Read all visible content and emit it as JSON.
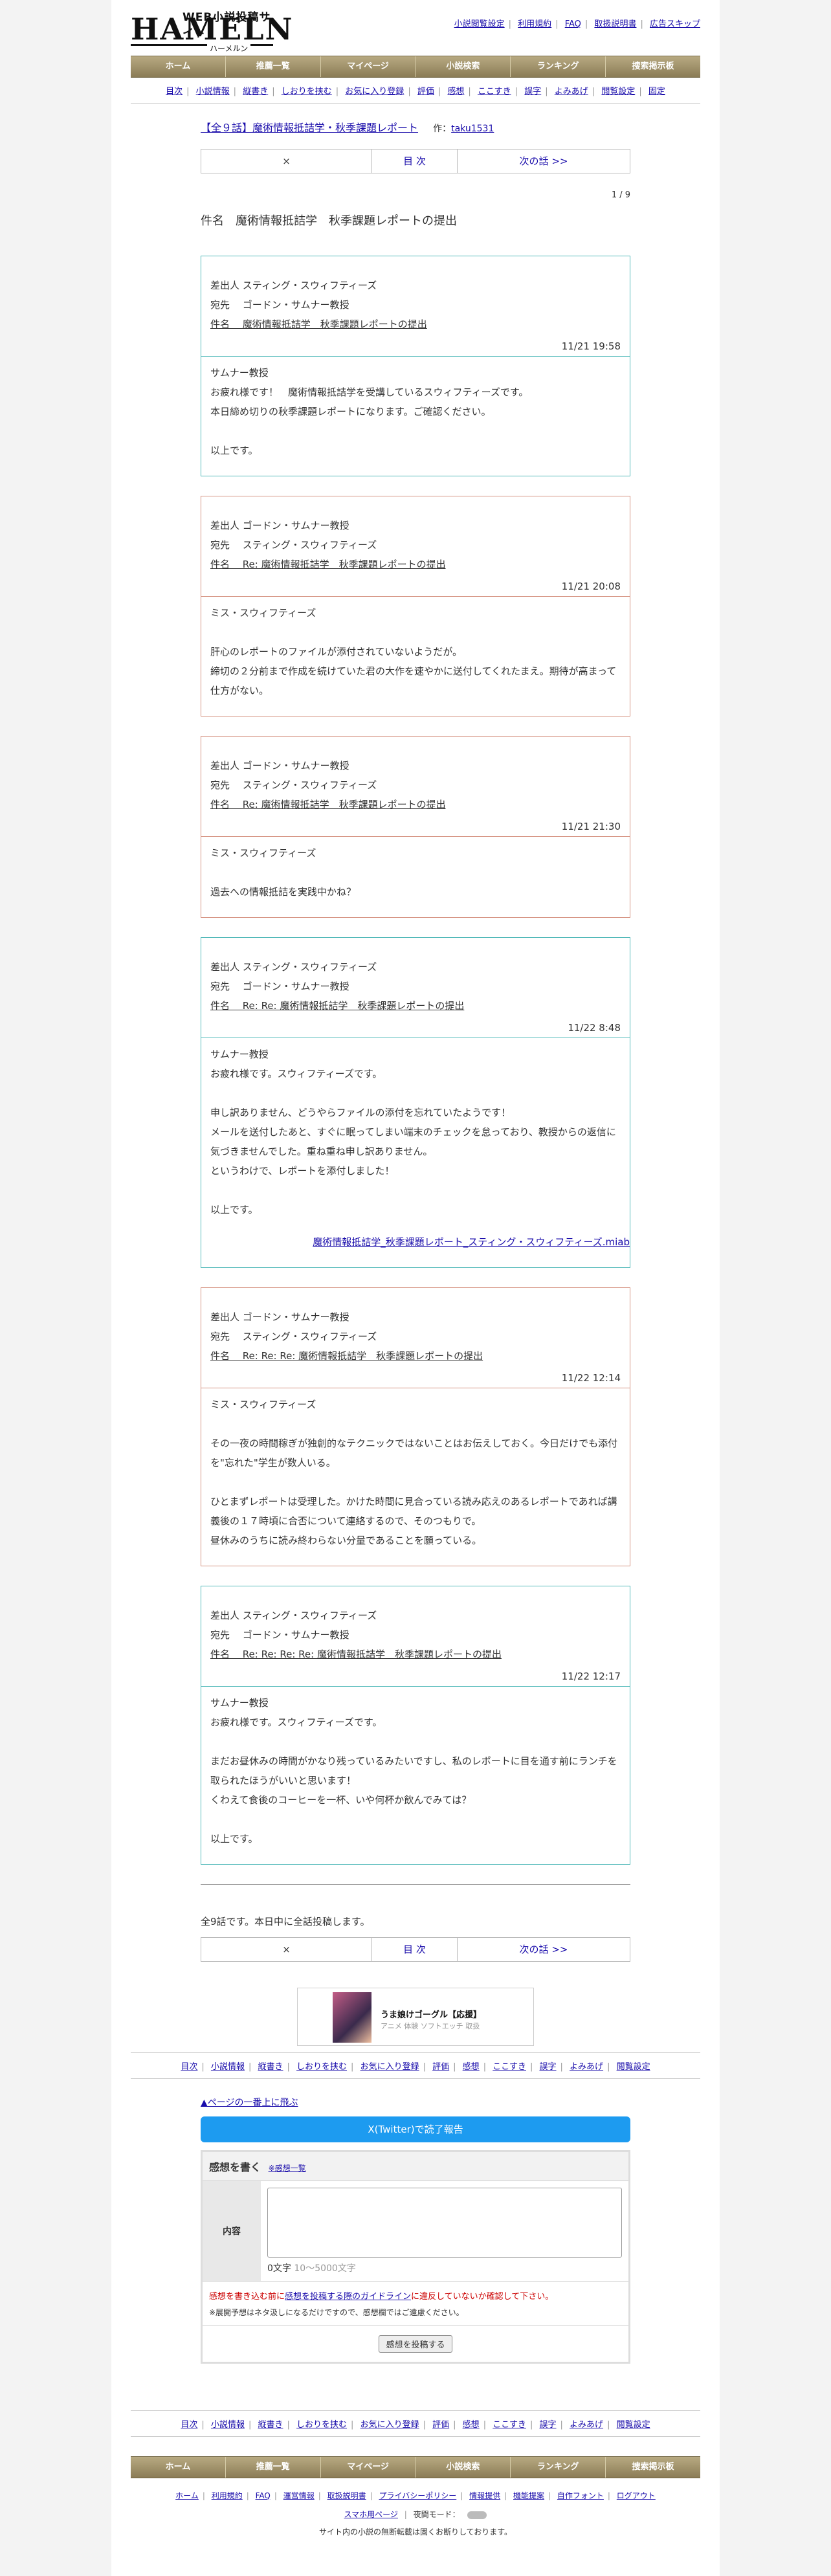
{
  "header": {
    "logo_top": "WEB小説投稿サイト",
    "logo_big": "HAMELN",
    "logo_kana": "ハーメルン",
    "top_links": [
      "小説閲覧設定",
      "利用規約",
      "FAQ",
      "取扱説明書",
      "広告スキップ"
    ]
  },
  "main_nav": [
    "ホーム",
    "推薦一覧",
    "マイページ",
    "小説検索",
    "ランキング",
    "捜索掲示板"
  ],
  "sub_nav": [
    "目次",
    "小説情報",
    "縦書き",
    "しおりを挟む",
    "お気に入り登録",
    "評価",
    "感想",
    "ここすき",
    "誤字",
    "よみあげ",
    "閲覧設定",
    "固定"
  ],
  "chapter": {
    "title": "【全９話】魔術情報抵詰学・秋季課題レポート",
    "author_prefix": "作：",
    "author": "taku1531",
    "pager": {
      "prev": "×",
      "toc": "目 次",
      "next": "次の話 >>"
    },
    "page_num": "1 / 9",
    "subject": "件名　魔術情報抵詰学　秋季課題レポートの提出"
  },
  "mails": [
    {
      "from": "差出人 スティング・スウィフティーズ",
      "to": "宛先　 ゴードン・サムナー教授",
      "subject": "件名　 魔術情報抵詰学　秋季課題レポートの提出",
      "date": "11/21 19:58",
      "body": [
        "サムナー教授",
        "お疲れ様です！　魔術情報抵詰学を受講しているスウィフティーズです。",
        "本日締め切りの秋季課題レポートになります。ご確認ください。",
        "",
        "以上です。"
      ]
    },
    {
      "from": "差出人 ゴードン・サムナー教授",
      "to": "宛先　 スティング・スウィフティーズ",
      "subject": "件名　 Re: 魔術情報抵詰学　秋季課題レポートの提出",
      "date": "11/21 20:08",
      "body": [
        "ミス・スウィフティーズ",
        "",
        "肝心のレポートのファイルが添付されていないようだが。",
        "締切の２分前まで作成を続けていた君の大作を速やかに送付してくれたまえ。期待が高まって仕方がない。"
      ]
    },
    {
      "from": "差出人 ゴードン・サムナー教授",
      "to": "宛先　 スティング・スウィフティーズ",
      "subject": "件名　 Re: 魔術情報抵詰学　秋季課題レポートの提出",
      "date": "11/21 21:30",
      "body": [
        "ミス・スウィフティーズ",
        "",
        "過去への情報抵詰を実践中かね？"
      ]
    },
    {
      "from": "差出人 スティング・スウィフティーズ",
      "to": "宛先　 ゴードン・サムナー教授",
      "subject": "件名　 Re: Re: 魔術情報抵詰学　秋季課題レポートの提出",
      "date": "11/22 8:48",
      "body": [
        "サムナー教授",
        "お疲れ様です。スウィフティーズです。",
        "",
        "申し訳ありません、どうやらファイルの添付を忘れていたようです！",
        "メールを送付したあと、すぐに眠ってしまい端末のチェックを怠っており、教授からの返信に気づきませんでした。重ね重ね申し訳ありません。",
        "というわけで、レポートを添付しました！",
        "",
        "以上です。"
      ],
      "attachment": "魔術情報抵詰学_秋季課題レポート_スティング・スウィフティーズ.miab"
    },
    {
      "from": "差出人 ゴードン・サムナー教授",
      "to": "宛先　 スティング・スウィフティーズ",
      "subject": "件名　 Re: Re: Re: 魔術情報抵詰学　秋季課題レポートの提出",
      "date": "11/22 12:14",
      "body": [
        "ミス・スウィフティーズ",
        "",
        "その一夜の時間稼ぎが独創的なテクニックではないことはお伝えしておく。今日だけでも添付を\"忘れた\"学生が数人いる。",
        "",
        "ひとまずレポートは受理した。かけた時間に見合っている読み応えのあるレポートであれば講義後の１７時頃に合否について連絡するので、そのつもりで。",
        "昼休みのうちに読み終わらない分量であることを願っている。"
      ]
    },
    {
      "from": "差出人 スティング・スウィフティーズ",
      "to": "宛先　 ゴードン・サムナー教授",
      "subject": "件名　 Re: Re: Re: Re: 魔術情報抵詰学　秋季課題レポートの提出",
      "date": "11/22 12:17",
      "body": [
        "サムナー教授",
        "お疲れ様です。スウィフティーズです。",
        "",
        "まだお昼休みの時間がかなり残っているみたいですし、私のレポートに目を通す前にランチを取られたほうがいいと思います！",
        "くわえて食後のコーヒーを一杯、いや何杯か飲んでみては？",
        "",
        "以上です。"
      ]
    }
  ],
  "endnote": "全9話です。本日中に全話投稿します。",
  "banner": {
    "title": "うま娘けゴーグル【応援】",
    "sub": "アニメ 体験 ソフトエッチ 取扱"
  },
  "backtop": "▲ページの一番上に飛ぶ",
  "x_button": "X(Twitter)で読了報告",
  "review": {
    "title": "感想を書く",
    "list_link": "※感想一覧",
    "label": "内容",
    "count": "0文字",
    "count_placeholder": "10～5000文字",
    "warn_prefix": "感想を書き込む前に",
    "warn_link": "感想を投稿する際のガイドライン",
    "warn_suffix": "に違反していないか確認して下さい。",
    "note": "※展開予想はネタ汲しになるだけですので、感想欄ではご遠慮ください。",
    "submit": "感想を投稿する"
  },
  "footer": {
    "links": [
      "ホーム",
      "利用規約",
      "FAQ",
      "運営情報",
      "取扱説明書",
      "プライバシーポリシー",
      "情報提供",
      "機能提案",
      "自作フォント",
      "ログアウト"
    ],
    "mode": "スマホ用ページ",
    "mode2": "夜間モード：",
    "copyright": "サイト内の小説の無断転載は固くお断りしております。"
  }
}
